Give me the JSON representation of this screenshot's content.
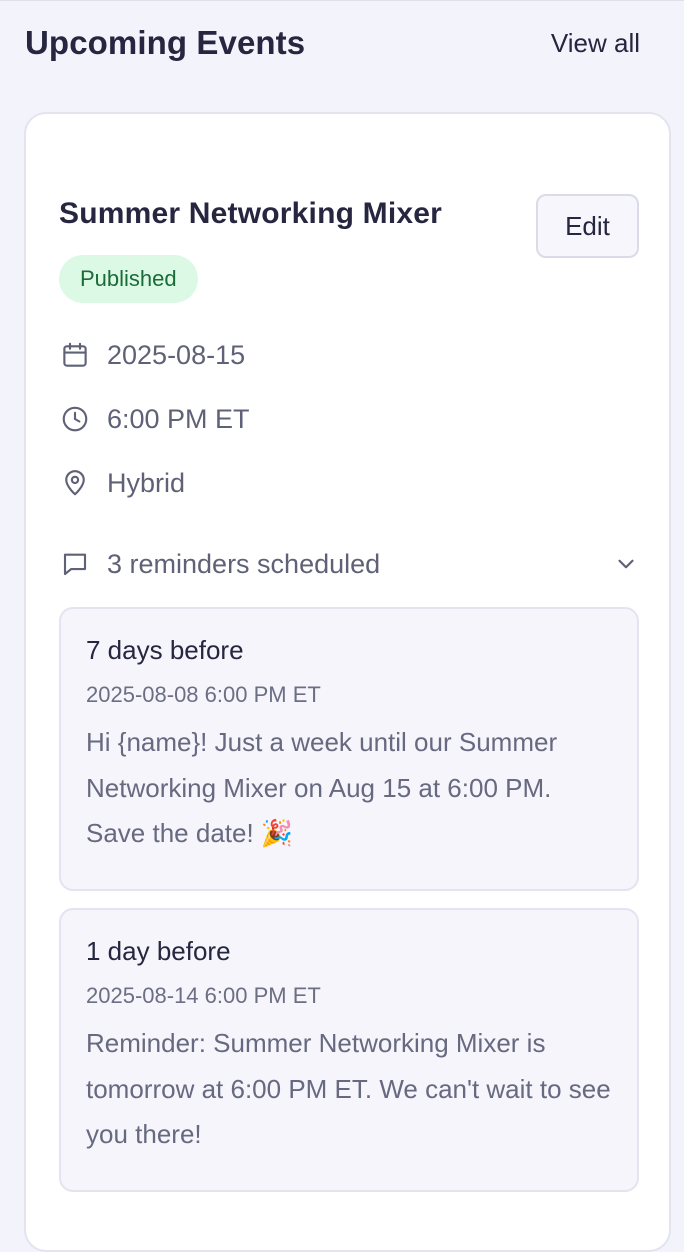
{
  "header": {
    "title": "Upcoming Events",
    "view_all": "View all"
  },
  "event": {
    "title": "Summer Networking Mixer",
    "edit_label": "Edit",
    "status": "Published",
    "date": "2025-08-15",
    "time": "6:00 PM ET",
    "location": "Hybrid",
    "reminders_summary": "3 reminders scheduled",
    "reminders": [
      {
        "label": "7 days before",
        "datetime": "2025-08-08 6:00 PM ET",
        "message": "Hi {name}! Just a week until our Summer Networking Mixer on Aug 15 at 6:00 PM. Save the date! 🎉"
      },
      {
        "label": "1 day before",
        "datetime": "2025-08-14 6:00 PM ET",
        "message": "Reminder: Summer Networking Mixer is tomorrow at 6:00 PM ET. We can't wait to see you there!"
      }
    ]
  },
  "colors": {
    "badge_bg": "#dcf9e6",
    "badge_text": "#1b6b38",
    "page_bg": "#f3f3fb"
  },
  "icons": [
    "calendar-icon",
    "clock-icon",
    "map-pin-icon",
    "message-icon",
    "chevron-down-icon"
  ]
}
